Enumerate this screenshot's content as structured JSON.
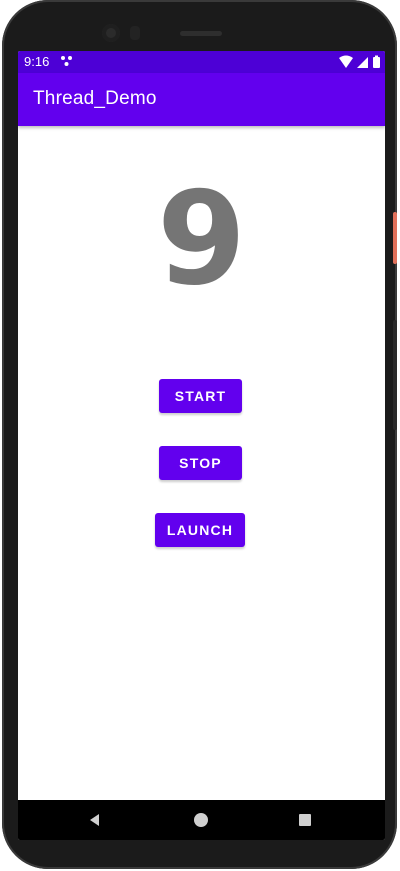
{
  "status_bar": {
    "time": "9:16",
    "notification_icon": "dots-icon",
    "wifi_icon": "wifi-icon",
    "signal_icon": "signal-icon",
    "battery_icon": "battery-icon"
  },
  "app_bar": {
    "title": "Thread_Demo",
    "color": "#6200ee"
  },
  "content": {
    "counter_value": "9",
    "counter_color": "#757575"
  },
  "buttons": {
    "start_label": "START",
    "stop_label": "STOP",
    "launch_label": "LAUNCH",
    "color": "#6200ee"
  },
  "nav_bar": {
    "back_icon": "back-triangle-icon",
    "home_icon": "home-circle-icon",
    "recents_icon": "recents-square-icon"
  }
}
